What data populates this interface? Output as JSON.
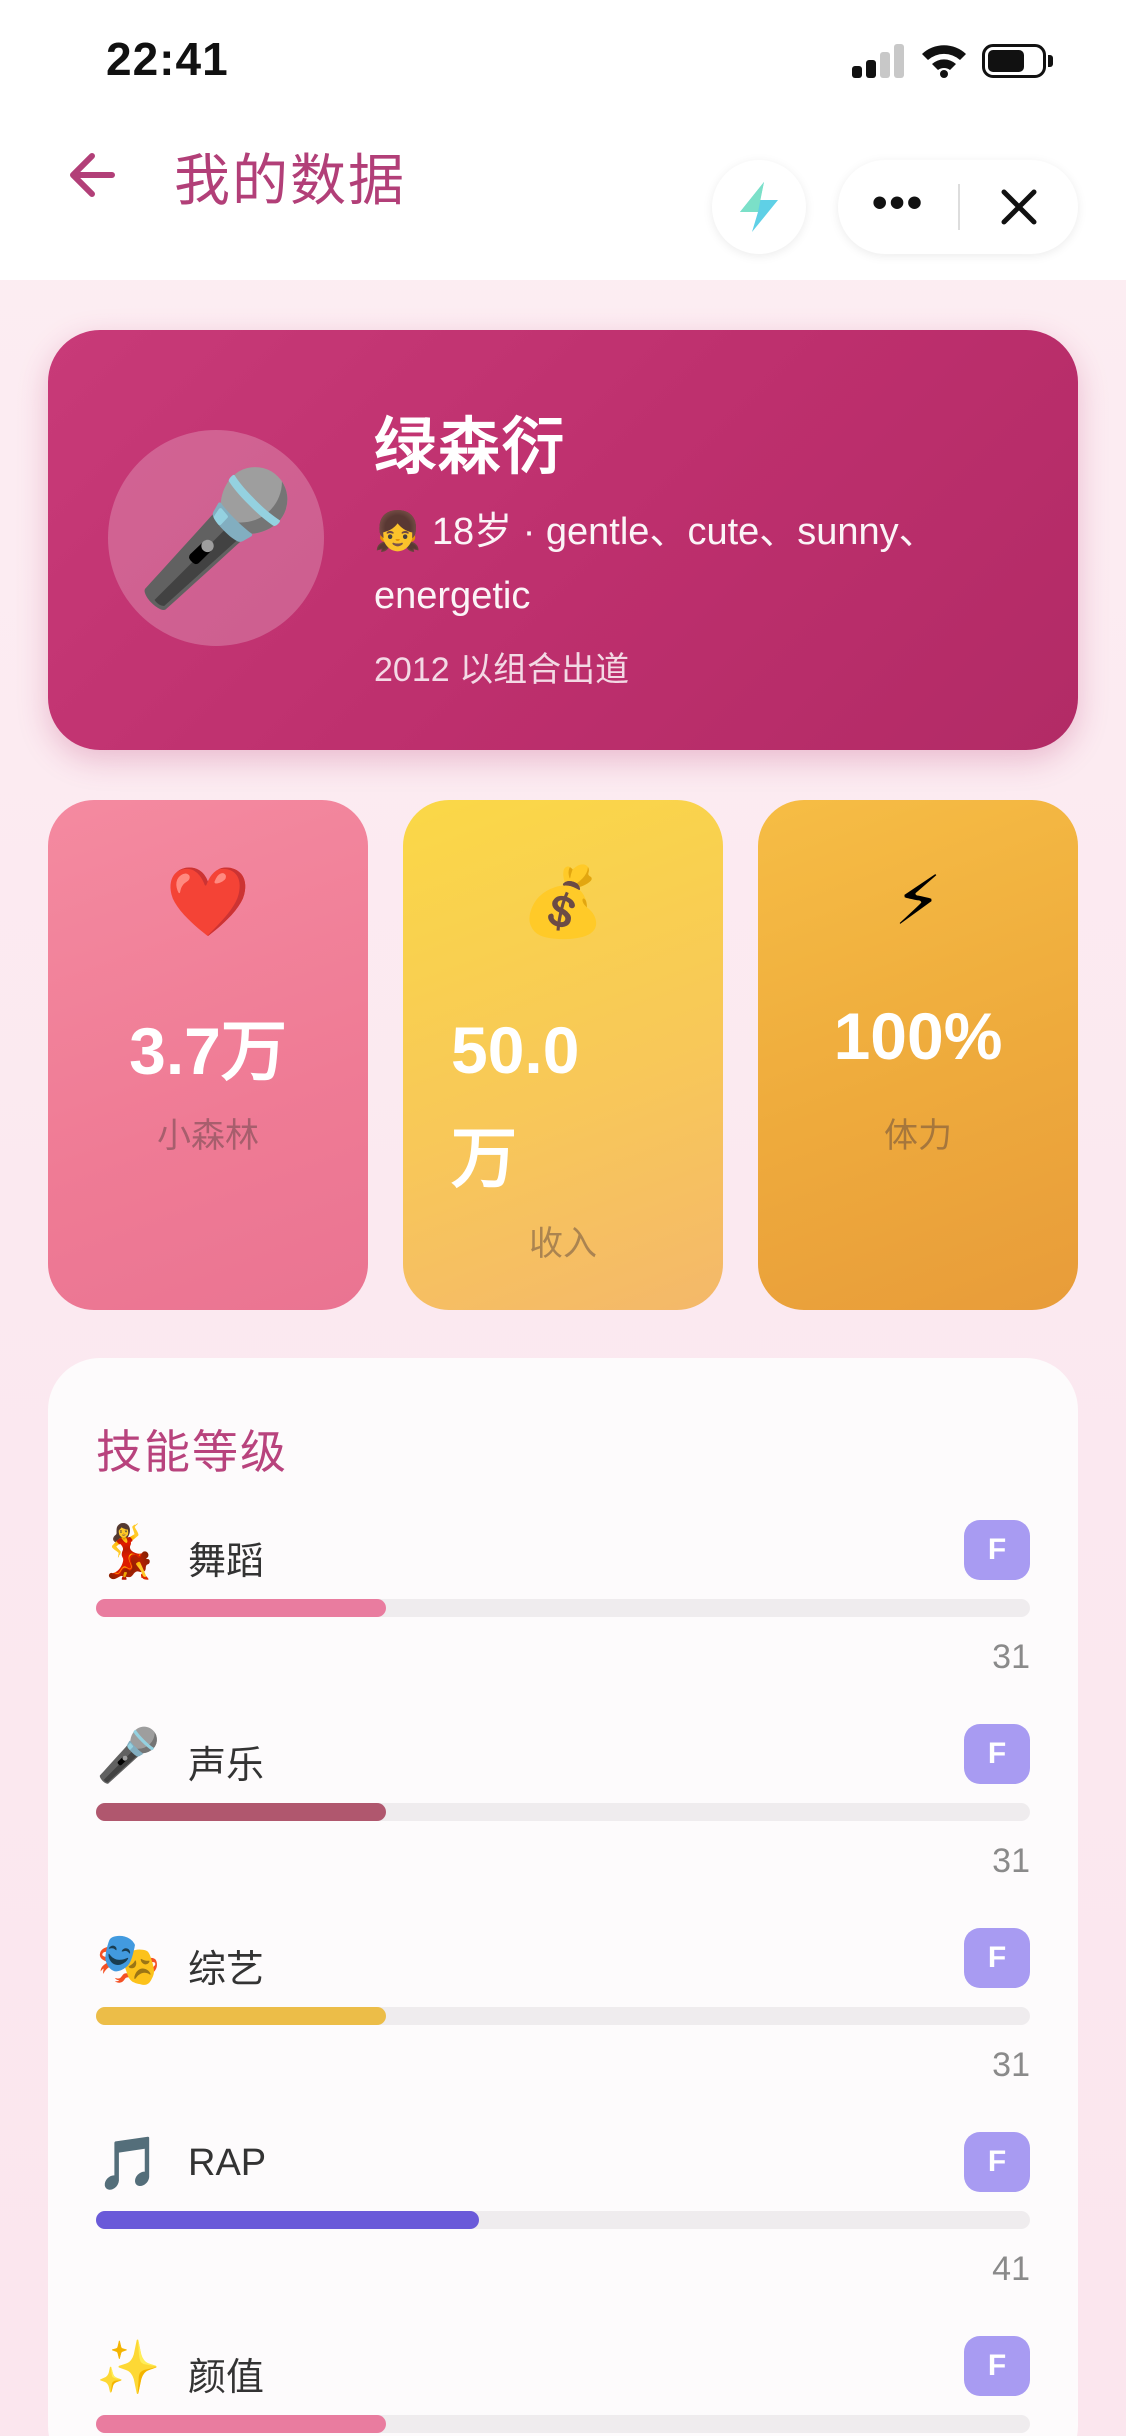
{
  "status_bar": {
    "time": "22:41"
  },
  "nav": {
    "title": "我的数据"
  },
  "profile": {
    "avatar_emoji": "🎤",
    "name": "绿森衍",
    "description": "👧 18岁 · gentle、cute、sunny、energetic",
    "debut": "2012 以组合出道"
  },
  "stats": [
    {
      "icon": "❤️",
      "value": "3.7万",
      "label": "小森林"
    },
    {
      "icon": "💰",
      "value": "50.0万",
      "label": "收入"
    },
    {
      "icon": "⚡",
      "value": "100%",
      "label": "体力"
    }
  ],
  "skills": {
    "title": "技能等级",
    "items": [
      {
        "icon": "💃",
        "name": "舞蹈",
        "grade": "F",
        "value": "31",
        "color": "#e97c9f"
      },
      {
        "icon": "🎤",
        "name": "声乐",
        "grade": "F",
        "value": "31",
        "color": "#b0576e"
      },
      {
        "icon": "🎭",
        "name": "综艺",
        "grade": "F",
        "value": "31",
        "color": "#ecbd48"
      },
      {
        "icon": "🎵",
        "name": "RAP",
        "grade": "F",
        "value": "41",
        "color": "#6a5ad9"
      },
      {
        "icon": "✨",
        "name": "颜值",
        "grade": "F",
        "value": "31",
        "color": "#e97c9f"
      }
    ]
  }
}
